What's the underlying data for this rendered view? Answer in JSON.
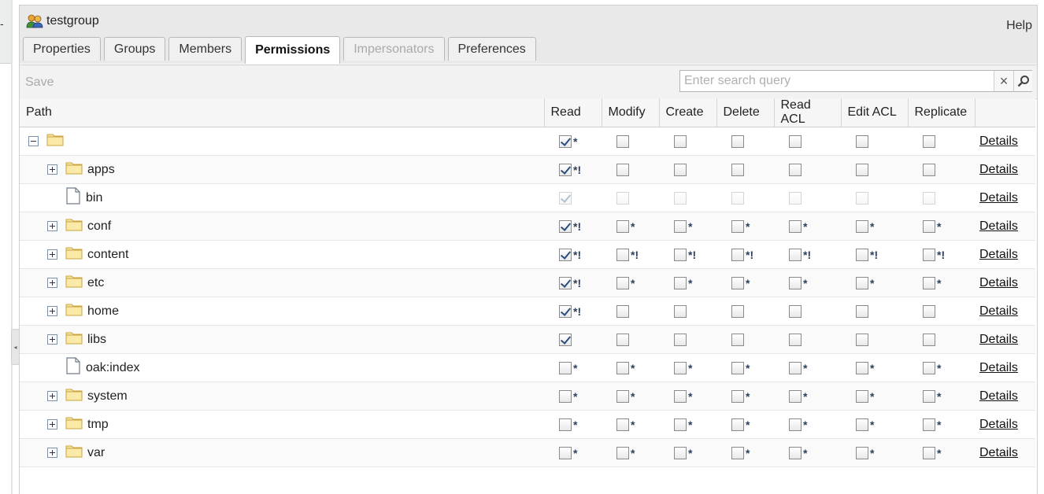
{
  "group": {
    "name": "testgroup"
  },
  "help_label": "Help",
  "tabs": [
    {
      "label": "Properties",
      "active": false,
      "disabled": false
    },
    {
      "label": "Groups",
      "active": false,
      "disabled": false
    },
    {
      "label": "Members",
      "active": false,
      "disabled": false
    },
    {
      "label": "Permissions",
      "active": true,
      "disabled": false
    },
    {
      "label": "Impersonators",
      "active": false,
      "disabled": true
    },
    {
      "label": "Preferences",
      "active": false,
      "disabled": false
    }
  ],
  "toolbar": {
    "save_label": "Save"
  },
  "search": {
    "placeholder": "Enter search query",
    "value": ""
  },
  "columns": [
    "Path",
    "Read",
    "Modify",
    "Create",
    "Delete",
    "Read ACL",
    "Edit ACL",
    "Replicate"
  ],
  "details_label": "Details",
  "rows": [
    {
      "name": "",
      "type": "folder",
      "expander": "minus",
      "indent": 0,
      "perms": [
        {
          "checked": true,
          "mark": "*"
        },
        {
          "checked": false,
          "mark": ""
        },
        {
          "checked": false,
          "mark": ""
        },
        {
          "checked": false,
          "mark": ""
        },
        {
          "checked": false,
          "mark": ""
        },
        {
          "checked": false,
          "mark": ""
        },
        {
          "checked": false,
          "mark": ""
        }
      ]
    },
    {
      "name": "apps",
      "type": "folder",
      "expander": "plus",
      "indent": 1,
      "perms": [
        {
          "checked": true,
          "mark": "*!"
        },
        {
          "checked": false,
          "mark": ""
        },
        {
          "checked": false,
          "mark": ""
        },
        {
          "checked": false,
          "mark": ""
        },
        {
          "checked": false,
          "mark": ""
        },
        {
          "checked": false,
          "mark": ""
        },
        {
          "checked": false,
          "mark": ""
        }
      ]
    },
    {
      "name": "bin",
      "type": "file",
      "expander": "",
      "indent": 1,
      "faded": true,
      "perms": [
        {
          "checked": true,
          "mark": ""
        },
        {
          "checked": false,
          "mark": ""
        },
        {
          "checked": false,
          "mark": ""
        },
        {
          "checked": false,
          "mark": ""
        },
        {
          "checked": false,
          "mark": ""
        },
        {
          "checked": false,
          "mark": ""
        },
        {
          "checked": false,
          "mark": ""
        }
      ]
    },
    {
      "name": "conf",
      "type": "folder",
      "expander": "plus",
      "indent": 1,
      "perms": [
        {
          "checked": true,
          "mark": "*!"
        },
        {
          "checked": false,
          "mark": "*"
        },
        {
          "checked": false,
          "mark": "*"
        },
        {
          "checked": false,
          "mark": "*"
        },
        {
          "checked": false,
          "mark": "*"
        },
        {
          "checked": false,
          "mark": "*"
        },
        {
          "checked": false,
          "mark": "*"
        }
      ]
    },
    {
      "name": "content",
      "type": "folder",
      "expander": "plus",
      "indent": 1,
      "perms": [
        {
          "checked": true,
          "mark": "*!"
        },
        {
          "checked": false,
          "mark": "*!"
        },
        {
          "checked": false,
          "mark": "*!"
        },
        {
          "checked": false,
          "mark": "*!"
        },
        {
          "checked": false,
          "mark": "*!"
        },
        {
          "checked": false,
          "mark": "*!"
        },
        {
          "checked": false,
          "mark": "*!"
        }
      ]
    },
    {
      "name": "etc",
      "type": "folder",
      "expander": "plus",
      "indent": 1,
      "perms": [
        {
          "checked": true,
          "mark": "*!"
        },
        {
          "checked": false,
          "mark": "*"
        },
        {
          "checked": false,
          "mark": "*"
        },
        {
          "checked": false,
          "mark": "*"
        },
        {
          "checked": false,
          "mark": "*"
        },
        {
          "checked": false,
          "mark": "*"
        },
        {
          "checked": false,
          "mark": "*"
        }
      ]
    },
    {
      "name": "home",
      "type": "folder",
      "expander": "plus",
      "indent": 1,
      "perms": [
        {
          "checked": true,
          "mark": "*!"
        },
        {
          "checked": false,
          "mark": ""
        },
        {
          "checked": false,
          "mark": ""
        },
        {
          "checked": false,
          "mark": ""
        },
        {
          "checked": false,
          "mark": ""
        },
        {
          "checked": false,
          "mark": ""
        },
        {
          "checked": false,
          "mark": ""
        }
      ]
    },
    {
      "name": "libs",
      "type": "folder",
      "expander": "plus",
      "indent": 1,
      "perms": [
        {
          "checked": true,
          "mark": ""
        },
        {
          "checked": false,
          "mark": ""
        },
        {
          "checked": false,
          "mark": ""
        },
        {
          "checked": false,
          "mark": ""
        },
        {
          "checked": false,
          "mark": ""
        },
        {
          "checked": false,
          "mark": ""
        },
        {
          "checked": false,
          "mark": ""
        }
      ]
    },
    {
      "name": "oak:index",
      "type": "file",
      "expander": "",
      "indent": 1,
      "perms": [
        {
          "checked": false,
          "mark": "*"
        },
        {
          "checked": false,
          "mark": "*"
        },
        {
          "checked": false,
          "mark": "*"
        },
        {
          "checked": false,
          "mark": "*"
        },
        {
          "checked": false,
          "mark": "*"
        },
        {
          "checked": false,
          "mark": "*"
        },
        {
          "checked": false,
          "mark": "*"
        }
      ]
    },
    {
      "name": "system",
      "type": "folder",
      "expander": "plus",
      "indent": 1,
      "perms": [
        {
          "checked": false,
          "mark": "*"
        },
        {
          "checked": false,
          "mark": "*"
        },
        {
          "checked": false,
          "mark": "*"
        },
        {
          "checked": false,
          "mark": "*"
        },
        {
          "checked": false,
          "mark": "*"
        },
        {
          "checked": false,
          "mark": "*"
        },
        {
          "checked": false,
          "mark": "*"
        }
      ]
    },
    {
      "name": "tmp",
      "type": "folder",
      "expander": "plus",
      "indent": 1,
      "perms": [
        {
          "checked": false,
          "mark": "*"
        },
        {
          "checked": false,
          "mark": "*"
        },
        {
          "checked": false,
          "mark": "*"
        },
        {
          "checked": false,
          "mark": "*"
        },
        {
          "checked": false,
          "mark": "*"
        },
        {
          "checked": false,
          "mark": "*"
        },
        {
          "checked": false,
          "mark": "*"
        }
      ]
    },
    {
      "name": "var",
      "type": "folder",
      "expander": "plus",
      "indent": 1,
      "perms": [
        {
          "checked": false,
          "mark": "*"
        },
        {
          "checked": false,
          "mark": "*"
        },
        {
          "checked": false,
          "mark": "*"
        },
        {
          "checked": false,
          "mark": "*"
        },
        {
          "checked": false,
          "mark": "*"
        },
        {
          "checked": false,
          "mark": "*"
        },
        {
          "checked": false,
          "mark": "*"
        }
      ]
    }
  ]
}
